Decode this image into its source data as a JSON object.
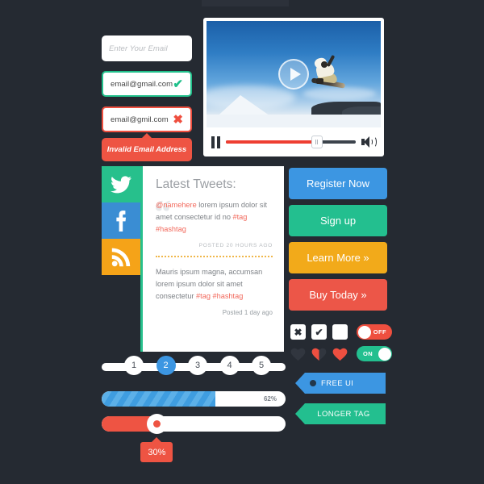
{
  "forms": {
    "empty_field": {
      "placeholder": "Enter Your Email",
      "icon": "none"
    },
    "valid_field": {
      "value": "email@gmail.com",
      "icon": "check-icon",
      "icon_glyph": "✔"
    },
    "invalid_field": {
      "value": "email@gmil.com",
      "icon": "cross-icon",
      "icon_glyph": "✖"
    },
    "error_message": "Invalid Email Address"
  },
  "video": {
    "play_icon": "play-icon",
    "pause_icon": "pause-icon",
    "volume_icon": "volume-icon",
    "progress_percent": 70,
    "scene": "snowboarder-jump"
  },
  "social": {
    "items": [
      {
        "name": "twitter",
        "color": "#27c08c"
      },
      {
        "name": "facebook",
        "color": "#3a8dd3"
      },
      {
        "name": "rss",
        "color": "#f5a318"
      }
    ]
  },
  "tweets": {
    "title": "Latest Tweets:",
    "accent_color": "#27c08c",
    "items": [
      {
        "handle": "@namehere",
        "body_1": " lorem ipsum dolor sit amet consectetur id no ",
        "tag_1": "#tag",
        "tag_2": "#hashtag",
        "meta": "POSTED 20 HOURS AGO"
      },
      {
        "body_1": "Mauris ipsum magna, accumsan lorem ipsum dolor sit amet consectetur ",
        "tag_1": "#tag",
        "tag_2": "#hashtag",
        "meta": "Posted 1 day ago"
      }
    ]
  },
  "ctas": [
    {
      "label": "Register Now",
      "color": "#3c96e2"
    },
    {
      "label": "Sign up",
      "color": "#23bf8f"
    },
    {
      "label": "Learn More »",
      "color": "#f2aa1a"
    },
    {
      "label": "Buy Today »",
      "color": "#ec5648"
    }
  ],
  "controls": {
    "checkbox_cross": "✖",
    "checkbox_check": "✔",
    "checkbox_empty": "",
    "toggle_off_label": "OFF",
    "toggle_on_label": "ON",
    "hearts": [
      "empty",
      "half",
      "full"
    ],
    "off_color": "#ef4f3f",
    "on_color": "#23bf8f"
  },
  "tags": [
    {
      "label": "FREE UI",
      "color": "#3c96e2"
    },
    {
      "label": "LONGER TAG",
      "color": "#23bf8f"
    }
  ],
  "pagination": {
    "pages": [
      "1",
      "2",
      "3",
      "4",
      "5"
    ],
    "active_index": 1,
    "active_color": "#3c96e2"
  },
  "progress": {
    "percent": 62,
    "label": "62%",
    "color": "#4ea6e3"
  },
  "slider": {
    "percent": 30,
    "label": "30%",
    "color": "#ee5443"
  }
}
